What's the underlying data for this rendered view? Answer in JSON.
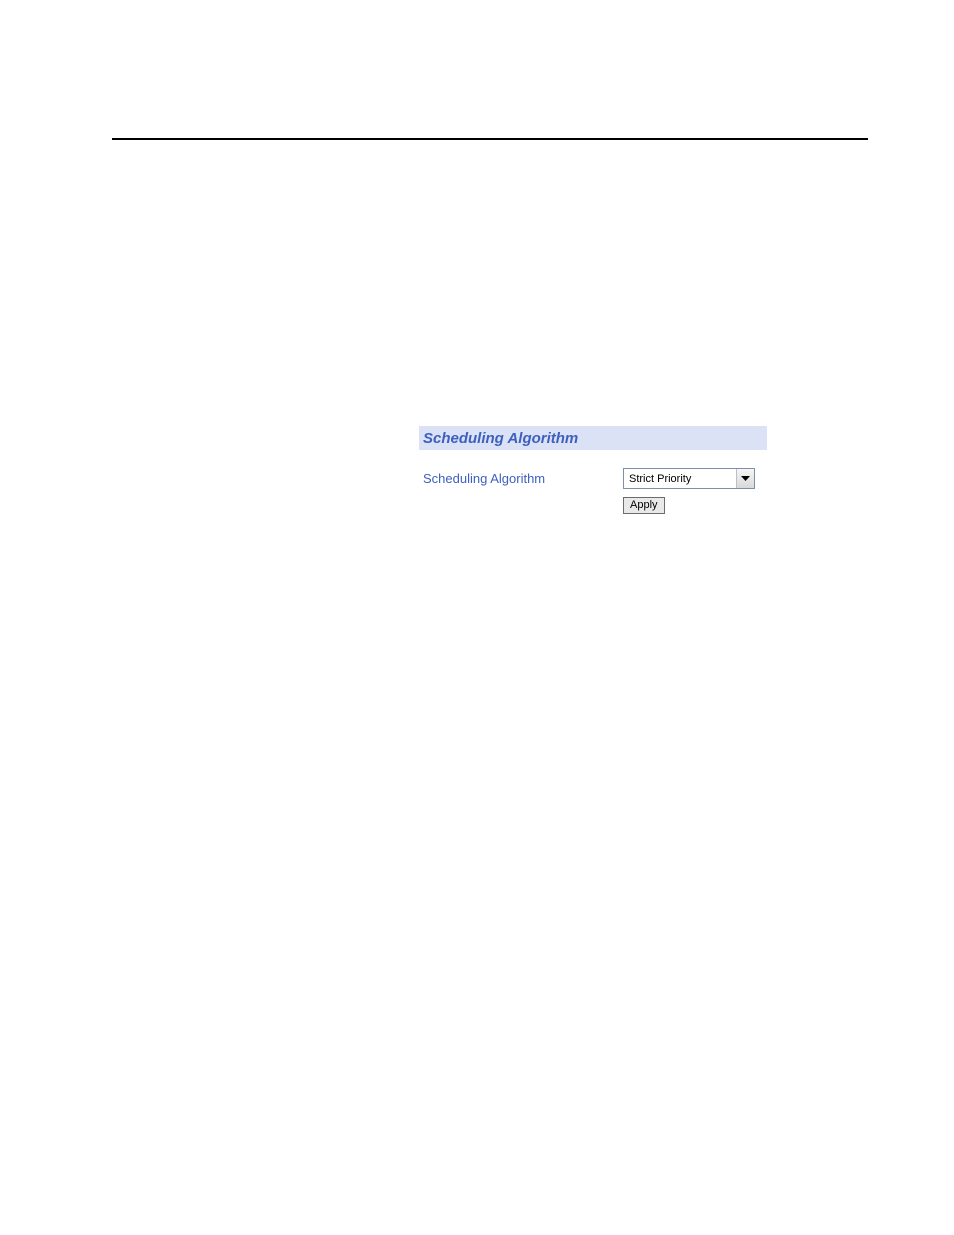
{
  "panel": {
    "title": "Scheduling Algorithm",
    "field_label": "Scheduling Algorithm",
    "select_value": "Strict Priority",
    "apply_label": "Apply"
  }
}
